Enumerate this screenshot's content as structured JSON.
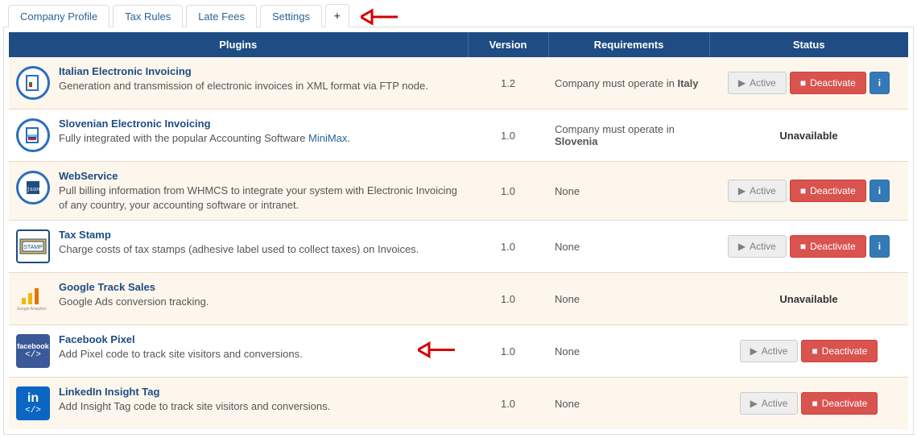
{
  "tabs": [
    {
      "label": "Company Profile",
      "active": false
    },
    {
      "label": "Tax Rules",
      "active": false
    },
    {
      "label": "Late Fees",
      "active": false
    },
    {
      "label": "Settings",
      "active": false
    },
    {
      "label": "+",
      "active": true,
      "is_plus": true
    }
  ],
  "table": {
    "headers": {
      "plugins": "Plugins",
      "version": "Version",
      "requirements": "Requirements",
      "status": "Status"
    }
  },
  "buttons": {
    "active": "Active",
    "deactivate": "Deactivate",
    "info": "i",
    "unavailable": "Unavailable"
  },
  "plugins": [
    {
      "icon": "invoice-it-icon",
      "title": "Italian Electronic Invoicing",
      "desc": "Generation and transmission of electronic invoices in XML format via FTP node.",
      "version": "1.2",
      "req_prefix": "Company must operate in ",
      "req_strong": "Italy",
      "status_mode": "full"
    },
    {
      "icon": "invoice-si-icon",
      "title": "Slovenian Electronic Invoicing",
      "desc_pre": "Fully integrated with the popular Accounting Software ",
      "desc_link": "MiniMax",
      "desc_post": ".",
      "version": "1.0",
      "req_prefix": "Company must operate in ",
      "req_strong": "Slovenia",
      "status_mode": "unavailable"
    },
    {
      "icon": "webservice-icon",
      "title": "WebService",
      "desc": "Pull billing information from WHMCS to integrate your system with Electronic Invoicing of any country, your accounting software or intranet.",
      "version": "1.0",
      "req_plain": "None",
      "status_mode": "full"
    },
    {
      "icon": "taxstamp-icon",
      "title": "Tax Stamp",
      "desc": "Charge costs of tax stamps (adhesive label used to collect taxes) on Invoices.",
      "version": "1.0",
      "req_plain": "None",
      "status_mode": "full"
    },
    {
      "icon": "google-analytics-icon",
      "title": "Google Track Sales",
      "desc": "Google Ads conversion tracking.",
      "version": "1.0",
      "req_plain": "None",
      "status_mode": "unavailable"
    },
    {
      "icon": "facebook-pixel-icon",
      "title": "Facebook Pixel",
      "desc": "Add Pixel code to track site visitors and conversions.",
      "version": "1.0",
      "req_plain": "None",
      "status_mode": "basic",
      "row_arrow": true
    },
    {
      "icon": "linkedin-insight-icon",
      "title": "LinkedIn Insight Tag",
      "desc": "Add Insight Tag code to track site visitors and conversions.",
      "version": "1.0",
      "req_plain": "None",
      "status_mode": "basic"
    }
  ]
}
